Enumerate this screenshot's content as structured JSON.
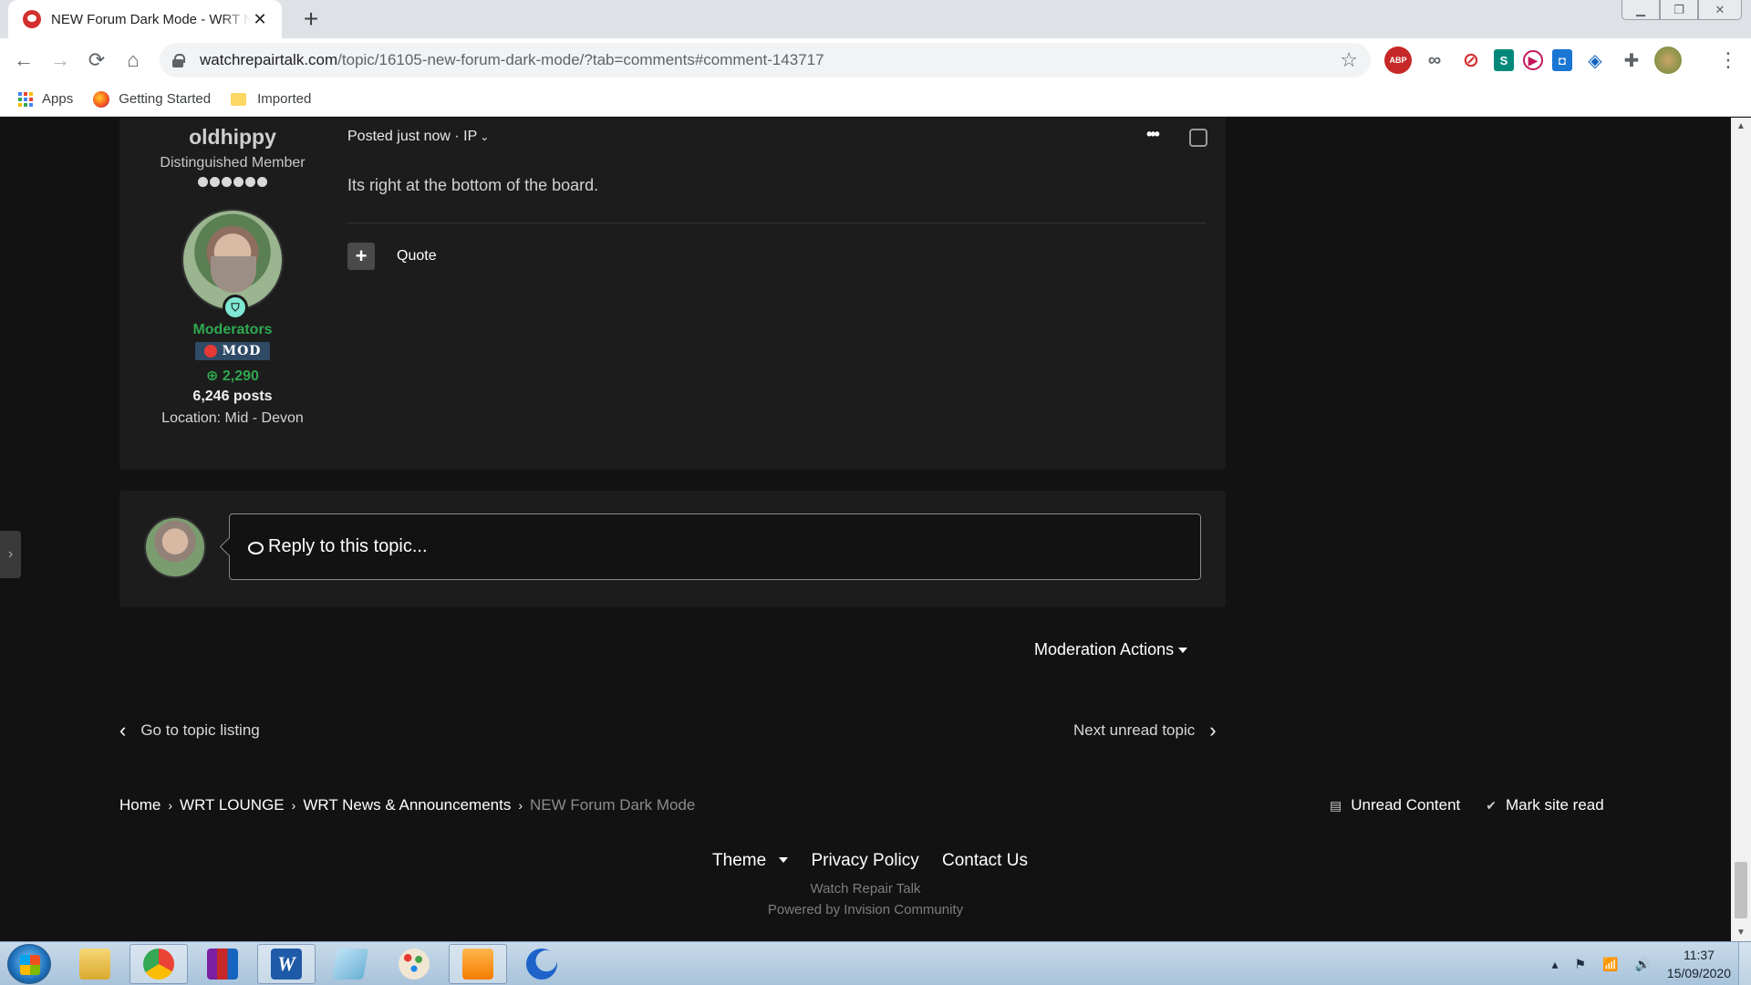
{
  "browser": {
    "tab_title": "NEW Forum Dark Mode - WRT News & Announcements",
    "tab_close": "✕",
    "new_tab": "+",
    "url_host": "watchrepairtalk.com",
    "url_path": "/topic/16105-new-forum-dark-mode/?tab=comments#comment-143717",
    "bookmarks": [
      {
        "label": "Apps"
      },
      {
        "label": "Getting Started"
      },
      {
        "label": "Imported"
      }
    ],
    "extensions": [
      "ABP",
      "∞",
      "⊘",
      "S",
      "▶",
      "◘",
      "◈",
      "✚"
    ]
  },
  "post": {
    "author_name": "oldhippy",
    "author_rank": "Distinguished Member",
    "group": "Moderators",
    "badge": "MOD",
    "reputation": "2,290",
    "posts": "6,246 posts",
    "location": "Location: Mid - Devon",
    "posted": "Posted just now · IP",
    "content": "Its right at the bottom of the board.",
    "quote_label": "Quote"
  },
  "reply": {
    "placeholder": "Reply to this topic..."
  },
  "moderation_actions": "Moderation Actions",
  "pager": {
    "prev": "Go to topic listing",
    "next": "Next unread topic"
  },
  "breadcrumb": [
    {
      "label": "Home"
    },
    {
      "label": "WRT LOUNGE"
    },
    {
      "label": "WRT News & Announcements"
    },
    {
      "label": "NEW Forum Dark Mode"
    }
  ],
  "quick_links": {
    "unread": "Unread Content",
    "mark_read": "Mark site read"
  },
  "footer": {
    "theme": "Theme",
    "privacy": "Privacy Policy",
    "contact": "Contact Us",
    "brand": "Watch Repair Talk",
    "powered": "Powered by Invision Community"
  },
  "taskbar": {
    "time": "11:37",
    "date": "15/09/2020"
  },
  "colors": {
    "page_bg": "#121212",
    "panel_bg": "#1c1c1c",
    "group_green": "#2fa84f"
  }
}
